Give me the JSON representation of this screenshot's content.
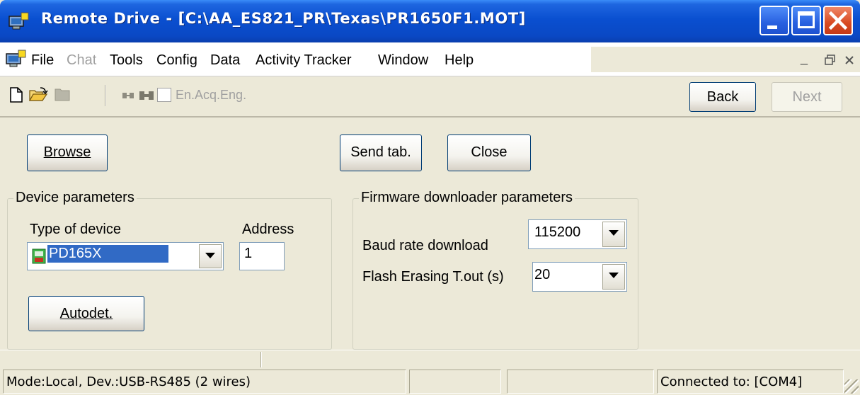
{
  "window": {
    "title": "Remote Drive - [C:\\AA_ES821_PR\\Texas\\PR1650F1.MOT]"
  },
  "menu": {
    "file": "File",
    "chat": "Chat",
    "tools": "Tools",
    "config": "Config",
    "data": "Data",
    "activity_tracker": "Activity Tracker",
    "window": "Window",
    "help": "Help"
  },
  "toolbar": {
    "en_acq_eng": "En.Acq.Eng.",
    "back": "Back",
    "next": "Next"
  },
  "main": {
    "browse": "Browse",
    "send_tab": "Send tab.",
    "close": "Close"
  },
  "device_params": {
    "title": "Device parameters",
    "type_label": "Type of device",
    "type_value": "PD165X",
    "address_label": "Address",
    "address_value": "1",
    "autodet": "Autodet."
  },
  "firmware_params": {
    "title": "Firmware downloader parameters",
    "baud_label": "Baud rate download",
    "baud_value": "115200",
    "flash_label": "Flash Erasing T.out (s)",
    "flash_value": "20"
  },
  "status": {
    "mode": "Mode:Local, Dev.:USB-RS485 (2 wires)",
    "connected": "Connected to: [COM4]"
  },
  "colors": {
    "titlebar": "#0A48C4",
    "selection": "#316AC5",
    "close_button": "#D84A22",
    "window_bg": "#ECE9D8"
  },
  "icons": {
    "app": "computer-icon",
    "new": "new-document-icon",
    "open": "open-folder-icon",
    "folder": "folder-icon",
    "connect": "plug-icon",
    "device": "pd-device-icon"
  }
}
